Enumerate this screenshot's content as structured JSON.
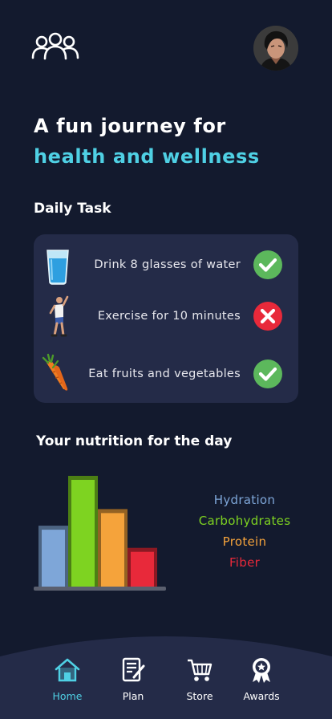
{
  "header": {
    "group_icon": "users-group-icon",
    "avatar": "user-avatar"
  },
  "hero": {
    "line1": "A fun journey for",
    "line2": "health and wellness"
  },
  "daily_task": {
    "title": "Daily Task",
    "tasks": [
      {
        "label": "Drink 8 glasses of water",
        "icon": "water-glass-icon",
        "status": "done"
      },
      {
        "label": "Exercise for 10 minutes",
        "icon": "exercise-person-icon",
        "status": "not-done"
      },
      {
        "label": "Eat fruits and vegetables",
        "icon": "carrot-icon",
        "status": "done"
      }
    ],
    "colors": {
      "done": "#5cb85c",
      "not_done": "#e8293a"
    }
  },
  "nutrition": {
    "title": "Your nutrition for the day",
    "legend": [
      {
        "label": "Hydration",
        "color": "#7ea6d8"
      },
      {
        "label": "Carbohydrates",
        "color": "#7ed321"
      },
      {
        "label": "Protein",
        "color": "#f5a33b"
      },
      {
        "label": "Fiber",
        "color": "#e8293a"
      }
    ]
  },
  "chart_data": {
    "type": "bar",
    "categories": [
      "Hydration",
      "Carbohydrates",
      "Protein",
      "Fiber"
    ],
    "values": [
      55,
      100,
      70,
      35
    ],
    "ylim": [
      0,
      100
    ],
    "colors": [
      "#7ea6d8",
      "#7ed321",
      "#f5a33b",
      "#e8293a"
    ],
    "grid": false
  },
  "nav": {
    "items": [
      {
        "label": "Home",
        "icon": "home-icon",
        "active": true
      },
      {
        "label": "Plan",
        "icon": "plan-icon",
        "active": false
      },
      {
        "label": "Store",
        "icon": "cart-icon",
        "active": false
      },
      {
        "label": "Awards",
        "icon": "award-icon",
        "active": false
      }
    ],
    "accent": "#4fd0e4"
  }
}
